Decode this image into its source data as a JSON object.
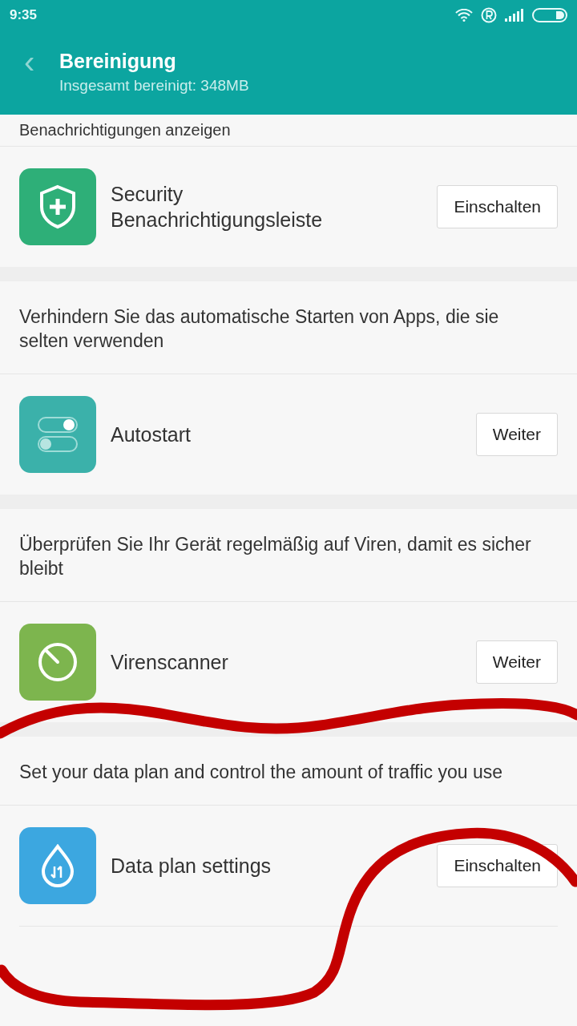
{
  "status_bar": {
    "time": "9:35"
  },
  "header": {
    "back": "‹",
    "title": "Bereinigung",
    "subtitle": "Insgesamt bereinigt: 348MB"
  },
  "sections": [
    {
      "caption": "Benachrichtigungen anzeigen",
      "item": {
        "kind": "shield",
        "title": "Security Benachrichtigungsleiste",
        "button": "Einschalten"
      }
    },
    {
      "caption": "Verhindern Sie das automatische Starten von Apps, die sie selten verwenden",
      "item": {
        "kind": "toggles",
        "title": "Autostart",
        "button": "Weiter"
      }
    },
    {
      "caption": "Überprüfen Sie Ihr Gerät regelmäßig auf Viren, damit es sicher bleibt",
      "item": {
        "kind": "scanner",
        "title": "Virenscanner",
        "button": "Weiter"
      }
    },
    {
      "caption": "Set your data plan and control the amount of traffic you use",
      "item": {
        "kind": "drop",
        "title": "Data plan settings",
        "button": "Einschalten"
      }
    }
  ]
}
